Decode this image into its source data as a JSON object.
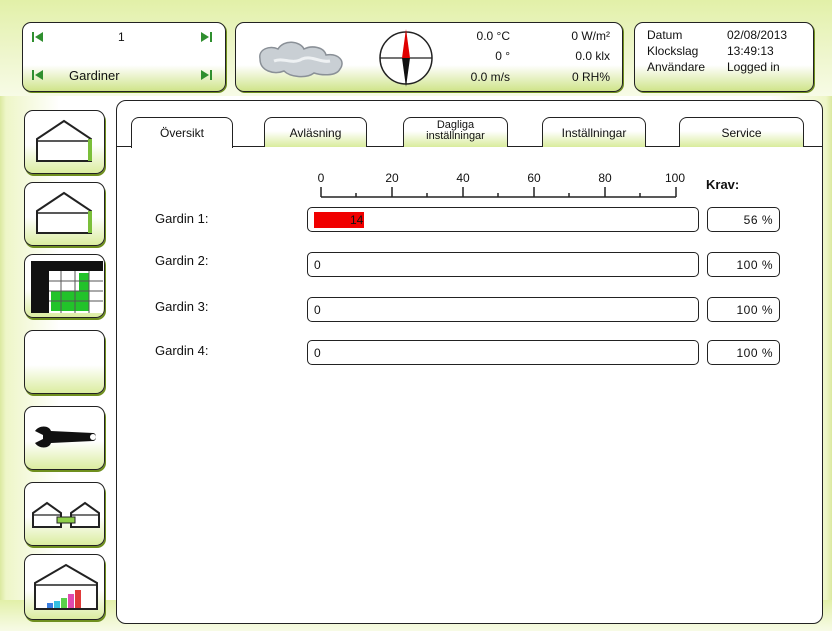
{
  "header": {
    "nav": {
      "number": "1",
      "section": "Gardiner"
    },
    "weather": {
      "temperature": "0.0 °C",
      "direction": "0 °",
      "wind": "0.0 m/s",
      "radiation": "0 W/m²",
      "light": "0.0 klx",
      "humidity": "0 RH%"
    },
    "info": {
      "date_label": "Datum",
      "date_value": "02/08/2013",
      "time_label": "Klockslag",
      "time_value": "13:49:13",
      "user_label": "Användare",
      "user_value": "Logged in"
    }
  },
  "sidebar": {
    "items": [
      {
        "name": "greenhouse-icon"
      },
      {
        "name": "greenhouse-icon"
      },
      {
        "name": "schedule-grid-icon"
      },
      {
        "name": "empty"
      },
      {
        "name": "wrench-icon"
      },
      {
        "name": "linked-greenhouses-icon"
      },
      {
        "name": "greenhouse-chart-icon"
      }
    ]
  },
  "tabs": [
    {
      "label": "Översikt",
      "active": true
    },
    {
      "label": "Avläsning"
    },
    {
      "label": "Dagliga inställningar",
      "line1": "Dagliga",
      "line2": "inställningar"
    },
    {
      "label": "Inställningar"
    },
    {
      "label": "Service"
    }
  ],
  "scale": {
    "ticks": [
      "0",
      "20",
      "40",
      "60",
      "80",
      "100"
    ],
    "krav_header": "Krav:"
  },
  "rows": [
    {
      "label": "Gardin 1:",
      "value": "14",
      "fill_percent": 14,
      "krav": "56 %"
    },
    {
      "label": "Gardin 2:",
      "value": "0",
      "fill_percent": 0,
      "krav": "100 %"
    },
    {
      "label": "Gardin 3:",
      "value": "0",
      "fill_percent": 0,
      "krav": "100 %"
    },
    {
      "label": "Gardin 4:",
      "value": "0",
      "fill_percent": 0,
      "krav": "100 %"
    }
  ],
  "colors": {
    "accent_green": "#cfe48a",
    "bar_fill": "#f00000",
    "compass_red": "#e00000"
  }
}
